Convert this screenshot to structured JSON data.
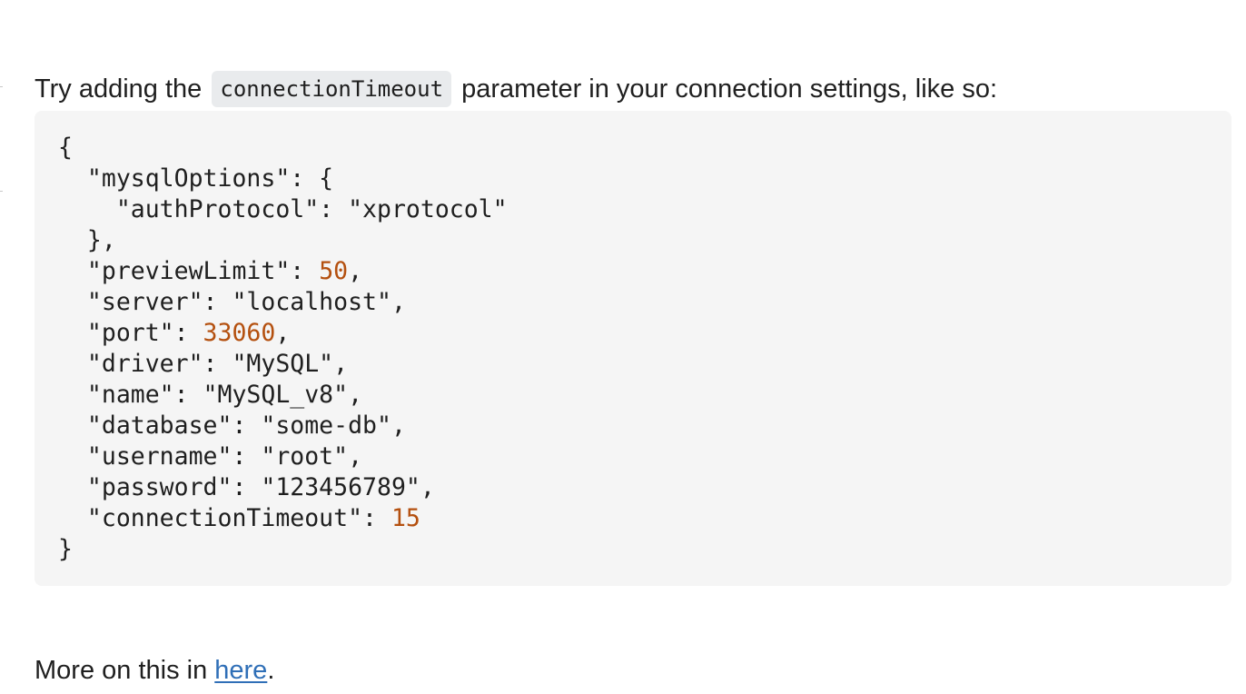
{
  "message": {
    "intro_before": "Try adding the ",
    "intro_code": "connectionTimeout",
    "intro_after": " parameter in your connection settings, like so:",
    "outro_before": "More on this in ",
    "outro_link": "here",
    "outro_after": "."
  },
  "code": {
    "lines": [
      {
        "pre": "{",
        "num": "",
        "post": ""
      },
      {
        "pre": "  \"mysqlOptions\": {",
        "num": "",
        "post": ""
      },
      {
        "pre": "    \"authProtocol\": \"xprotocol\"",
        "num": "",
        "post": ""
      },
      {
        "pre": "  },",
        "num": "",
        "post": ""
      },
      {
        "pre": "  \"previewLimit\": ",
        "num": "50",
        "post": ","
      },
      {
        "pre": "  \"server\": \"localhost\",",
        "num": "",
        "post": ""
      },
      {
        "pre": "  \"port\": ",
        "num": "33060",
        "post": ","
      },
      {
        "pre": "  \"driver\": \"MySQL\",",
        "num": "",
        "post": ""
      },
      {
        "pre": "  \"name\": \"MySQL_v8\",",
        "num": "",
        "post": ""
      },
      {
        "pre": "  \"database\": \"some-db\",",
        "num": "",
        "post": ""
      },
      {
        "pre": "  \"username\": \"root\",",
        "num": "",
        "post": ""
      },
      {
        "pre": "  \"password\": \"123456789\",",
        "num": "",
        "post": ""
      },
      {
        "pre": "  \"connectionTimeout\": ",
        "num": "15",
        "post": ""
      },
      {
        "pre": "}",
        "num": "",
        "post": ""
      }
    ]
  },
  "colors": {
    "number": "#b4500f",
    "link": "#2f6fb7",
    "code_background": "#f5f5f5",
    "inline_code_background": "#e9ebed"
  }
}
